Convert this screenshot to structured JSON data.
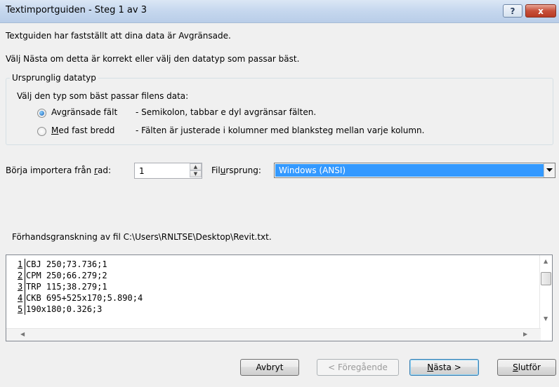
{
  "window": {
    "title": "Textimportguiden - Steg 1 av 3",
    "help_label": "?",
    "close_label": "x"
  },
  "intro": {
    "line1": "Textguiden har fastställt att dina data är Avgränsade.",
    "line2": "Välj Nästa om detta är korrekt eller välj den datatyp som passar bäst."
  },
  "datatype_group": {
    "legend": "Ursprunglig datatyp",
    "prompt": "Välj den typ som bäst passar filens data:",
    "options": [
      {
        "label_pre": "Av",
        "label_mn": "g",
        "label_post": "ränsade fält",
        "description": "- Semikolon, tabbar e dyl avgränsar fälten.",
        "checked": true
      },
      {
        "label_pre": "",
        "label_mn": "M",
        "label_post": "ed fast bredd",
        "description": "- Fälten är justerade i kolumner med blanksteg mellan varje kolumn.",
        "checked": false
      }
    ]
  },
  "import_row": {
    "label_pre": "Börja importera från ",
    "label_mn": "r",
    "label_post": "ad:",
    "value": "1"
  },
  "file_origin": {
    "label_pre": "Fil",
    "label_mn": "u",
    "label_post": "rsprung:",
    "selected": "Windows (ANSI)"
  },
  "preview": {
    "caption": "Förhandsgranskning av fil C:\\Users\\RNLTSE\\Desktop\\Revit.txt.",
    "lines": [
      {
        "num": "1",
        "text": "CBJ 250;73.736;1"
      },
      {
        "num": "2",
        "text": "CPM 250;66.279;2"
      },
      {
        "num": "3",
        "text": "TRP 115;38.279;1"
      },
      {
        "num": "4",
        "text": "CKB 695+525x170;5.890;4"
      },
      {
        "num": "5",
        "text": "190x180;0.326;3"
      }
    ]
  },
  "buttons": {
    "cancel": "Avbryt",
    "back": "< Föregående",
    "next_mn": "N",
    "next_post": "ästa >",
    "finish_mn": "S",
    "finish_post": "lutför"
  },
  "colors": {
    "selection": "#3399ff",
    "close_button": "#c7503a"
  }
}
